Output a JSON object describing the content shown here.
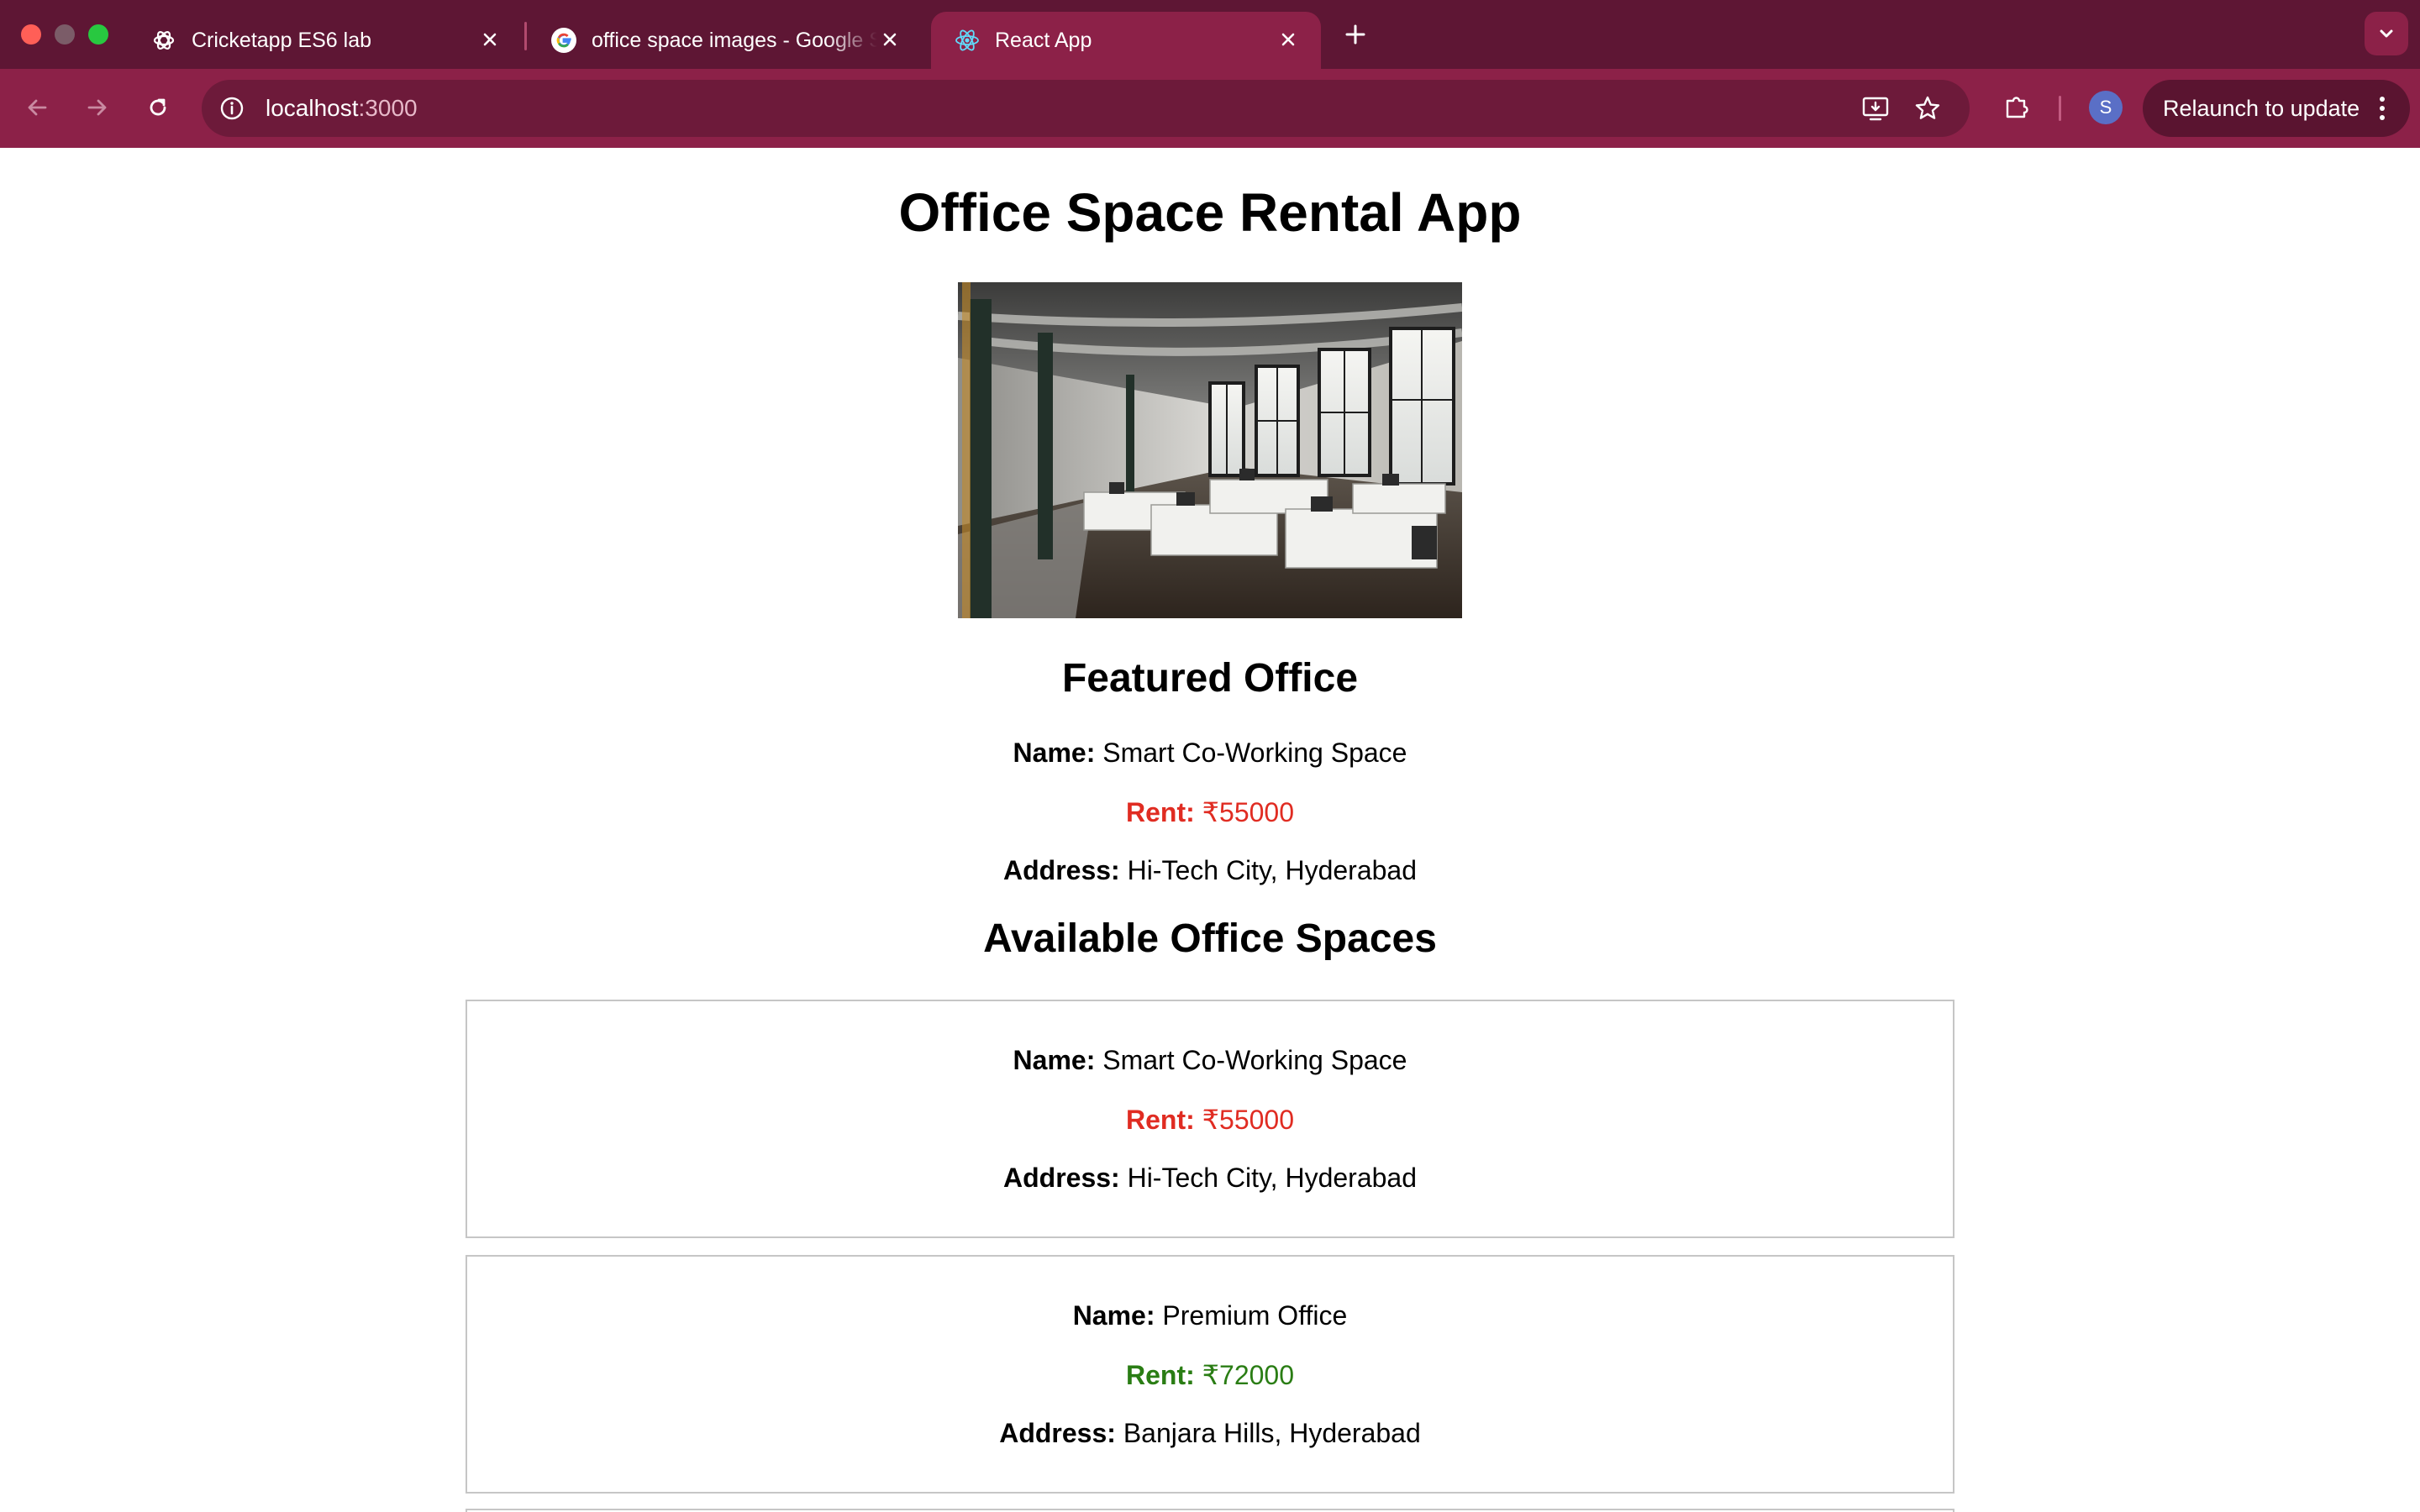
{
  "browser": {
    "tabs": [
      {
        "title": "Cricketapp ES6 lab",
        "icon": "openai-icon",
        "active": false
      },
      {
        "title": "office space images - Google Search",
        "icon": "google-icon",
        "active": false
      },
      {
        "title": "React App",
        "icon": "react-icon",
        "active": true
      }
    ],
    "url_host": "localhost",
    "url_port": ":3000",
    "profile_initial": "S",
    "relaunch_label": "Relaunch to update",
    "colors": {
      "tabstrip": "#5e1634",
      "toolbar": "#8c2148",
      "omnibox": "#6d1a3a"
    }
  },
  "page": {
    "title": "Office Space Rental App",
    "hero_alt": "office-photo",
    "featured": {
      "heading": "Featured Office",
      "name_label": "Name:",
      "name": "Smart Co-Working Space",
      "rent_label": "Rent:",
      "rent": "₹55000",
      "address_label": "Address:",
      "address": "Hi-Tech City, Hyderabad"
    },
    "available_heading": "Available Office Spaces",
    "offices": [
      {
        "name_label": "Name:",
        "name": "Smart Co-Working Space",
        "rent_label": "Rent:",
        "rent": "₹55000",
        "rent_color": "#e02c22",
        "address_label": "Address:",
        "address": "Hi-Tech City, Hyderabad"
      },
      {
        "name_label": "Name:",
        "name": "Premium Office",
        "rent_label": "Rent:",
        "rent": "₹72000",
        "rent_color": "#2a7d14",
        "address_label": "Address:",
        "address": "Banjara Hills, Hyderabad"
      }
    ]
  }
}
